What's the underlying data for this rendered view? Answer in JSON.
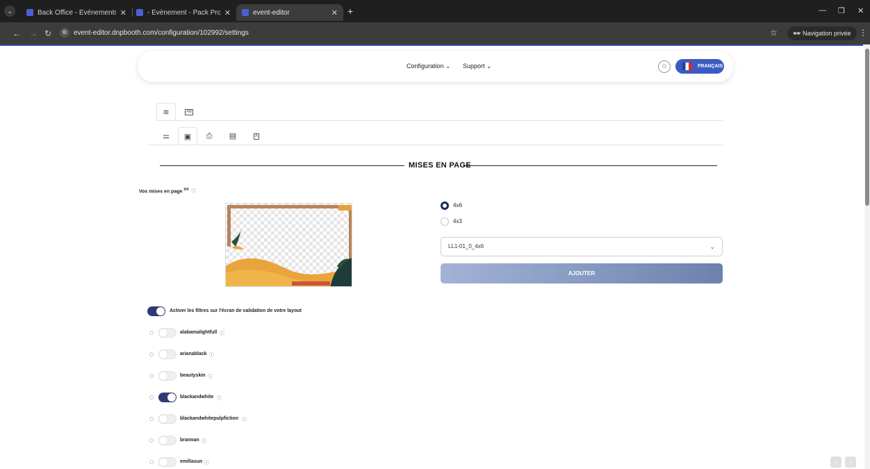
{
  "browser": {
    "tabs": [
      {
        "title": "Back Office - Evénements : Nou",
        "close": "✕"
      },
      {
        "title": "- Évènement - Pack Pro Data (D",
        "close": "✕"
      },
      {
        "title": "event-editor",
        "close": "✕"
      }
    ],
    "new_tab": "+",
    "url": "event-editor.dnpbooth.com/configuration/102992/settings",
    "private_label": "Navigation privée"
  },
  "header": {
    "menu": [
      {
        "label": "Configuration ⌄"
      },
      {
        "label": "Support ⌄"
      }
    ],
    "language": "FRANÇAIS"
  },
  "section": {
    "title": "MISES EN PAGE"
  },
  "layouts": {
    "label": "Vos mises en page",
    "count": "0/4",
    "help": "ⓘ",
    "formats": [
      {
        "label": "4x6",
        "checked": true
      },
      {
        "label": "4x3",
        "checked": false
      }
    ],
    "selected_layout": "LL1-01_0_4x6",
    "add_button": "AJOUTER"
  },
  "filters": {
    "master_toggle": {
      "label": "Activer les filtres sur l'écran de validation de votre layout",
      "on": true
    },
    "items": [
      {
        "name": "alabamalightfull",
        "on": false
      },
      {
        "name": "arianablack",
        "on": false
      },
      {
        "name": "beautyskin",
        "on": false
      },
      {
        "name": "blackandwhite",
        "on": true
      },
      {
        "name": "blackandwhitepulpfiction",
        "on": false
      },
      {
        "name": "brannan",
        "on": false
      },
      {
        "name": "emillasun",
        "on": false
      }
    ]
  },
  "colors": {
    "accent": "#2e3a72",
    "language_pill": "#3b5bc4",
    "browser_dark": "#1f1f1f"
  }
}
